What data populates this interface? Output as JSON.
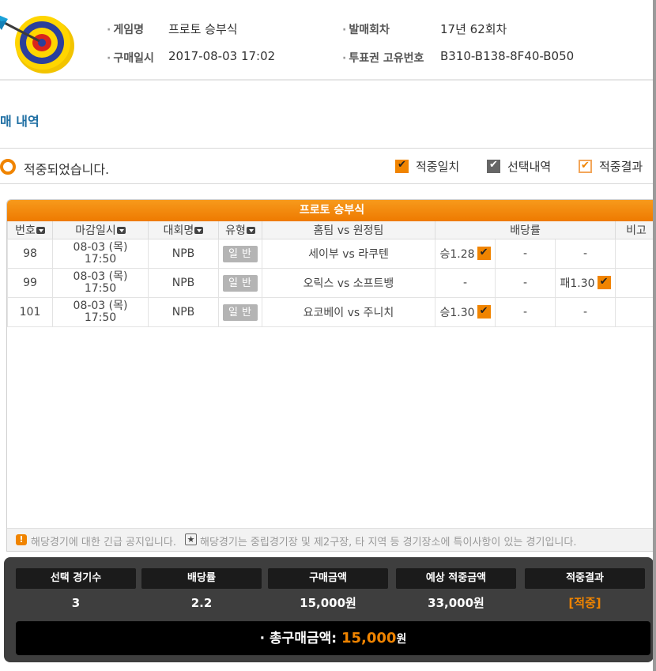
{
  "header": {
    "game_name_label": "게임명",
    "game_name": "프로토 승부식",
    "purchase_date_label": "구매일시",
    "purchase_date": "2017-08-03 17:02",
    "round_label": "발매회차",
    "round": "17년 62회차",
    "ticket_id_label": "투표권 고유번호",
    "ticket_id": "B310-B138-8F40-B050"
  },
  "section_title": "매 내역",
  "status": {
    "text": "적중되었습니다.",
    "legend": [
      "적중일치",
      "선택내역",
      "적중결과"
    ]
  },
  "panel_title": "프로토 승부식",
  "columns": [
    "번호",
    "마감일시",
    "대회명",
    "유형",
    "홈팀 vs 원정팀",
    "배당률",
    "비고"
  ],
  "rows": [
    {
      "no": "98",
      "date": "08-03 (목)",
      "time": "17:50",
      "league": "NPB",
      "type": "일반",
      "teams": "세이부 vs 라쿠텐",
      "odd1": "승1.28",
      "odd2": "-",
      "odd3": "-"
    },
    {
      "no": "99",
      "date": "08-03 (목)",
      "time": "17:50",
      "league": "NPB",
      "type": "일반",
      "teams": "오릭스 vs 소프트뱅",
      "odd1": "-",
      "odd2": "-",
      "odd3": "패1.30"
    },
    {
      "no": "101",
      "date": "08-03 (목)",
      "time": "17:50",
      "league": "NPB",
      "type": "일반",
      "teams": "요코베이 vs 주니치",
      "odd1": "승1.30",
      "odd2": "-",
      "odd3": "-"
    }
  ],
  "notice": {
    "urgent": "해당경기에 대한 긴급 공지입니다.",
    "special": "해당경기는 중립경기장 및 제2구장, 타 지역 등 경기장소에 특이사항이 있는 경기입니다."
  },
  "summary": {
    "labels": [
      "선택 경기수",
      "배당률",
      "구매금액",
      "예상 적중금액",
      "적중결과"
    ],
    "values": [
      "3",
      "2.2",
      "15,000원",
      "33,000원",
      "[적중]"
    ],
    "total_label": "총구매금액:",
    "total_amount": "15,000",
    "total_unit": "원"
  },
  "colors": {
    "accent": "#f08400",
    "title_blue": "#1f6fa3",
    "summary_bg": "#3e3e3e"
  }
}
